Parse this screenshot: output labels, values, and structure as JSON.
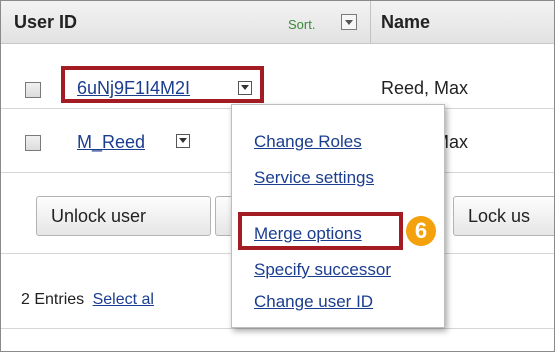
{
  "table": {
    "header": {
      "user_id": "User ID",
      "sort": "Sort.",
      "name": "Name"
    },
    "rows": [
      {
        "user_id": "6uNj9F1I4M2I",
        "name": "Reed, Max"
      },
      {
        "user_id": "M_Reed",
        "name": "Reed, Max"
      }
    ]
  },
  "buttons": {
    "unlock": "Unlock user",
    "lock": "Lock us"
  },
  "footer": {
    "entries": "2 Entries",
    "select_all": "Select al"
  },
  "context_menu": {
    "items": [
      "Change Roles",
      "Service settings",
      "Merge options",
      "Specify successor",
      "Change user ID"
    ]
  },
  "annotation": {
    "step": "6"
  },
  "colors": {
    "highlight": "#a31c23",
    "badge": "#f3a10c",
    "link": "#1b3d8f",
    "sort": "#3a8a3a"
  }
}
